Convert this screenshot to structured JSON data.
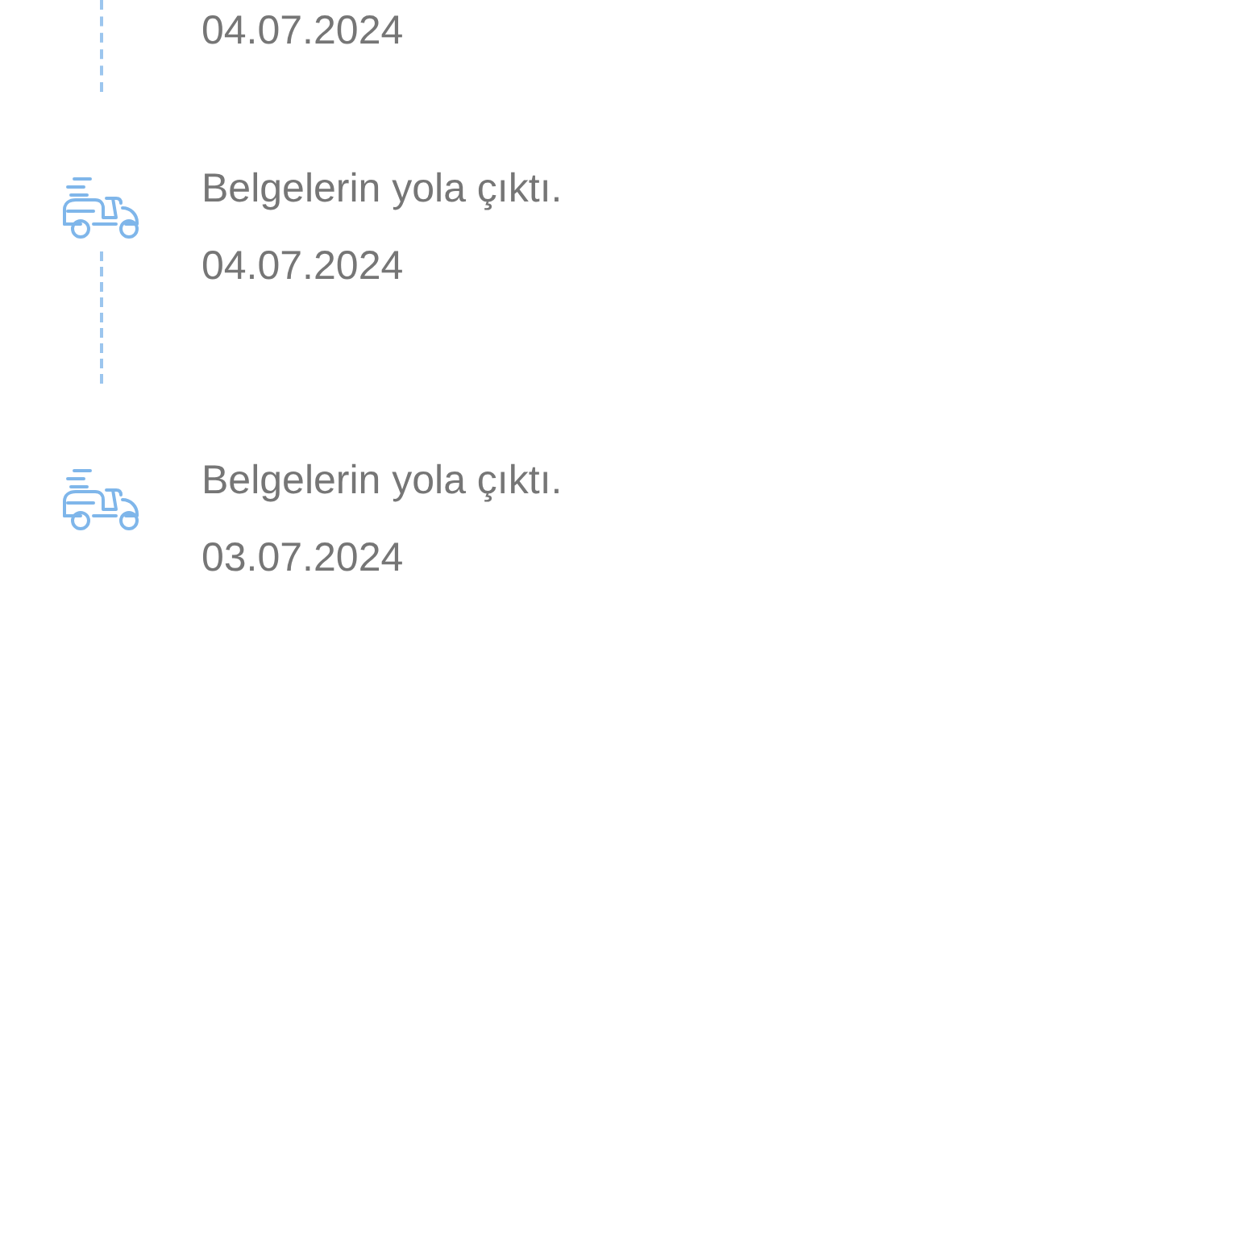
{
  "timeline": [
    {
      "kind": "cut",
      "date": "04.07.2024"
    },
    {
      "kind": "event",
      "title": "Belgelerin yola çıktı.",
      "date": "04.07.2024"
    },
    {
      "kind": "event",
      "title": "Belgelerin yola çıktı.",
      "date": "03.07.2024"
    }
  ]
}
